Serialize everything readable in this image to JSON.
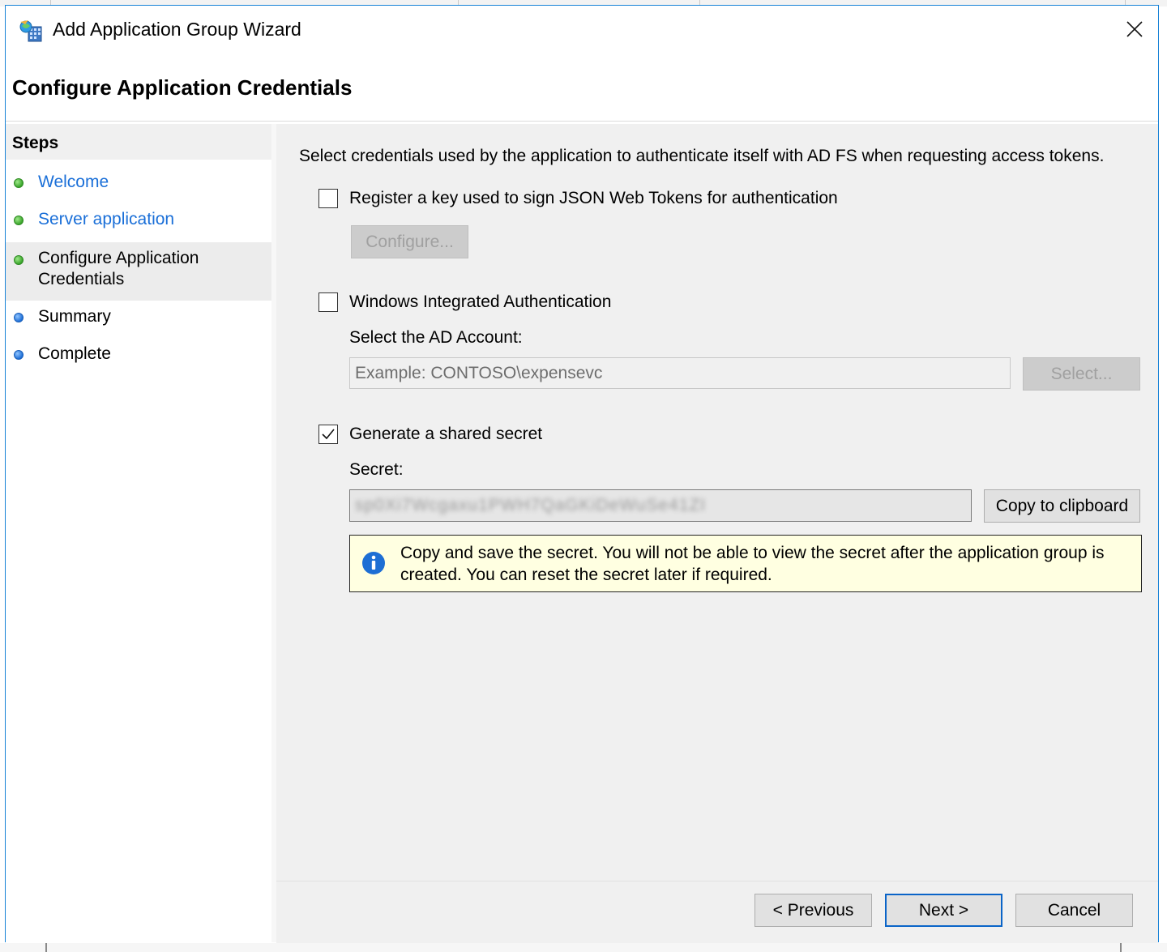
{
  "window": {
    "title": "Add Application Group Wizard",
    "page_heading": "Configure Application Credentials",
    "icons": {
      "app": "app-group-wizard-icon",
      "close": "close-icon"
    }
  },
  "steps": {
    "header": "Steps",
    "items": [
      {
        "label": "Welcome",
        "status": "done",
        "link": true
      },
      {
        "label": "Server application",
        "status": "done",
        "link": true
      },
      {
        "label_line1": "Configure Application",
        "label_line2": "Credentials",
        "status": "current",
        "link": false
      },
      {
        "label": "Summary",
        "status": "pending",
        "link": false
      },
      {
        "label": "Complete",
        "status": "pending",
        "link": false
      }
    ]
  },
  "content": {
    "intro": "Select credentials used by the application to authenticate itself with AD FS when requesting access tokens.",
    "jwt": {
      "checkbox_label": "Register a key used to sign JSON Web Tokens for authentication",
      "checked": false,
      "configure_button": "Configure..."
    },
    "wia": {
      "checkbox_label": "Windows Integrated Authentication",
      "checked": false,
      "account_label": "Select the AD Account:",
      "account_placeholder": "Example: CONTOSO\\expensevc",
      "select_button": "Select..."
    },
    "secret": {
      "checkbox_label": "Generate a shared secret",
      "checked": true,
      "secret_label": "Secret:",
      "secret_value": "sp0Xi7Wcgaxu1PWH7QaGKiDeWuSe41ZI",
      "copy_button": "Copy to clipboard",
      "info_line1": "Copy and save the secret.  You will not be able to view the secret after the application group is",
      "info_line2": "created.  You can reset the secret later if required."
    }
  },
  "footer": {
    "previous": "< Previous",
    "next": "Next >",
    "cancel": "Cancel"
  },
  "colors": {
    "accent": "#1883d7",
    "link": "#1a6fd8",
    "panel_bg": "#f0f0f0",
    "info_bg": "#ffffe1",
    "done_dot": "#3aa52b",
    "pending_dot": "#1f6fd6"
  }
}
